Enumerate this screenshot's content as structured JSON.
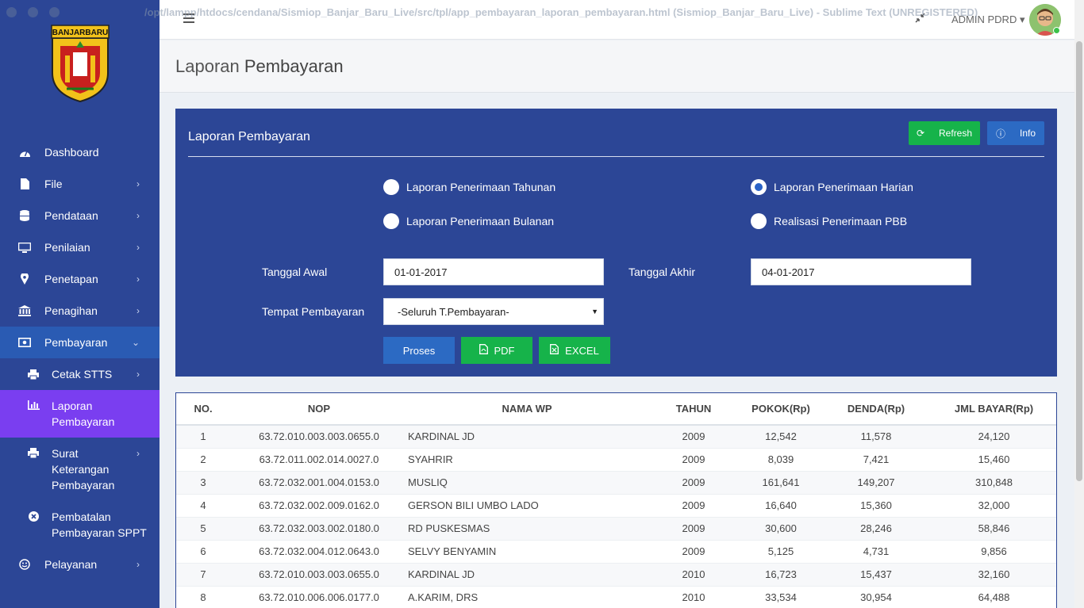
{
  "window": {
    "title": "/opt/lampp/htdocs/cendana/Sismiop_Banjar_Baru_Live/src/tpl/app_pembayaran_laporan_pembayaran.html (Sismiop_Banjar_Baru_Live) - Sublime Text (UNREGISTERED)"
  },
  "sidebar": {
    "logo_text": "BANJARBARU",
    "items": [
      {
        "label": "Dashboard",
        "icon": "dashboard-icon"
      },
      {
        "label": "File",
        "icon": "file-icon"
      },
      {
        "label": "Pendataan",
        "icon": "database-icon"
      },
      {
        "label": "Penilaian",
        "icon": "monitor-icon"
      },
      {
        "label": "Penetapan",
        "icon": "map-marker-icon"
      },
      {
        "label": "Penagihan",
        "icon": "bank-icon"
      },
      {
        "label": "Pembayaran",
        "icon": "money-icon"
      }
    ],
    "subitems": [
      {
        "label": "Cetak STTS",
        "icon": "print-icon"
      },
      {
        "label": "Laporan Pembayaran",
        "icon": "bar-chart-icon"
      },
      {
        "label": "Surat Keterangan Pembayaran",
        "icon": "print-icon"
      },
      {
        "label": "Pembatalan Pembayaran SPPT",
        "icon": "times-circle-icon"
      }
    ],
    "after": [
      {
        "label": "Pelayanan",
        "icon": "smile-icon"
      }
    ]
  },
  "topbar": {
    "user": "ADMIN PDRD"
  },
  "page": {
    "title_light": "Laporan",
    "title_bold": "Pembayaran"
  },
  "panel": {
    "title": "Laporan Pembayaran",
    "refresh_label": "Refresh",
    "info_label": "Info",
    "radios": {
      "tahunan": "Laporan Penerimaan Tahunan",
      "bulanan": "Laporan Penerimaan Bulanan",
      "harian": "Laporan Penerimaan Harian",
      "realisasi": "Realisasi Penerimaan PBB",
      "selected": "harian"
    },
    "tanggal_awal_label": "Tanggal Awal",
    "tanggal_awal_value": "01-01-2017",
    "tanggal_akhir_label": "Tanggal Akhir",
    "tanggal_akhir_value": "04-01-2017",
    "tempat_label": "Tempat Pembayaran",
    "tempat_value": "-Seluruh T.Pembayaran-",
    "proses_label": "Proses",
    "pdf_label": "PDF",
    "excel_label": "EXCEL"
  },
  "colors": {
    "sidebar": "#2c4696",
    "active": "#7a3ef0",
    "green": "#16b34a",
    "blue": "#2c6ac3"
  },
  "table": {
    "headers": [
      "NO.",
      "NOP",
      "NAMA WP",
      "TAHUN",
      "POKOK(Rp)",
      "DENDA(Rp)",
      "JML BAYAR(Rp)"
    ],
    "rows": [
      [
        "1",
        "63.72.010.003.003.0655.0",
        "KARDINAL JD",
        "2009",
        "12,542",
        "11,578",
        "24,120"
      ],
      [
        "2",
        "63.72.011.002.014.0027.0",
        "SYAHRIR",
        "2009",
        "8,039",
        "7,421",
        "15,460"
      ],
      [
        "3",
        "63.72.032.001.004.0153.0",
        "MUSLIQ",
        "2009",
        "161,641",
        "149,207",
        "310,848"
      ],
      [
        "4",
        "63.72.032.002.009.0162.0",
        "GERSON BILI UMBO LADO",
        "2009",
        "16,640",
        "15,360",
        "32,000"
      ],
      [
        "5",
        "63.72.032.003.002.0180.0",
        "RD PUSKESMAS",
        "2009",
        "30,600",
        "28,246",
        "58,846"
      ],
      [
        "6",
        "63.72.032.004.012.0643.0",
        "SELVY BENYAMIN",
        "2009",
        "5,125",
        "4,731",
        "9,856"
      ],
      [
        "7",
        "63.72.010.003.003.0655.0",
        "KARDINAL JD",
        "2010",
        "16,723",
        "15,437",
        "32,160"
      ],
      [
        "8",
        "63.72.010.006.006.0177.0",
        "A.KARIM, DRS",
        "2010",
        "33,534",
        "30,954",
        "64,488"
      ]
    ]
  }
}
